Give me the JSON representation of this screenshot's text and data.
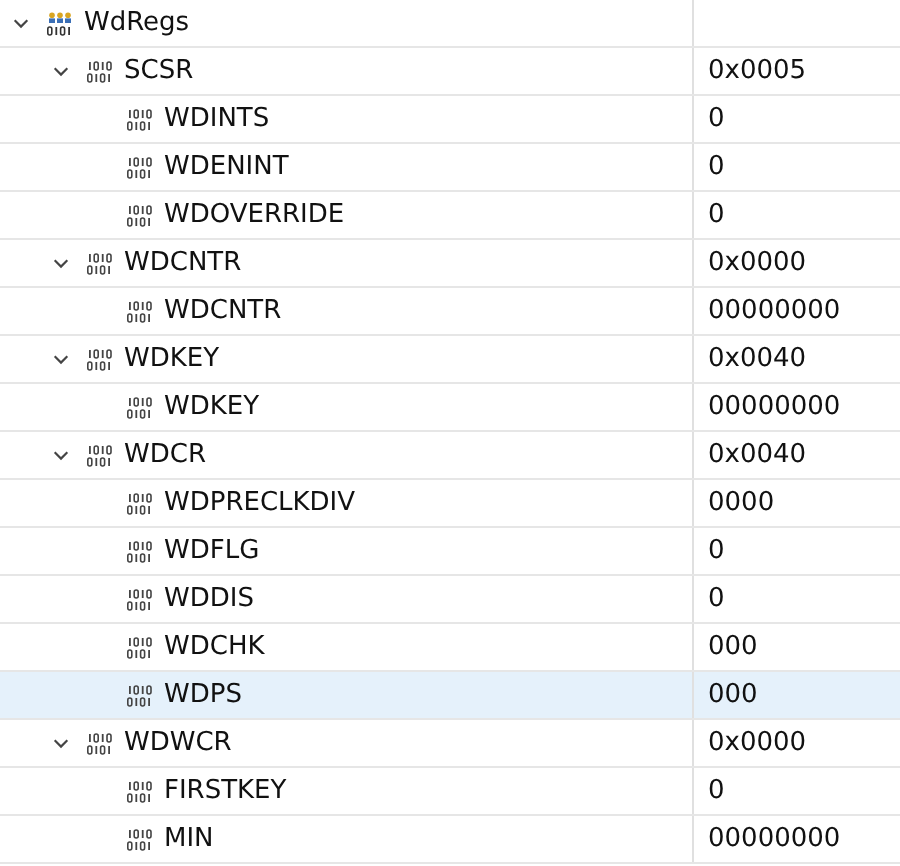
{
  "tree": [
    {
      "kind": "group",
      "name": "WdRegs",
      "expanded": true,
      "selected": false,
      "children": [
        {
          "kind": "register",
          "name": "SCSR",
          "value": "0x0005",
          "expanded": true,
          "selected": false,
          "children": [
            {
              "kind": "field",
              "name": "WDINTS",
              "value": "0",
              "selected": false
            },
            {
              "kind": "field",
              "name": "WDENINT",
              "value": "0",
              "selected": false
            },
            {
              "kind": "field",
              "name": "WDOVERRIDE",
              "value": "0",
              "selected": false
            }
          ]
        },
        {
          "kind": "register",
          "name": "WDCNTR",
          "value": "0x0000",
          "expanded": true,
          "selected": false,
          "children": [
            {
              "kind": "field",
              "name": "WDCNTR",
              "value": "00000000",
              "selected": false
            }
          ]
        },
        {
          "kind": "register",
          "name": "WDKEY",
          "value": "0x0040",
          "expanded": true,
          "selected": false,
          "children": [
            {
              "kind": "field",
              "name": "WDKEY",
              "value": "00000000",
              "selected": false
            }
          ]
        },
        {
          "kind": "register",
          "name": "WDCR",
          "value": "0x0040",
          "expanded": true,
          "selected": false,
          "children": [
            {
              "kind": "field",
              "name": "WDPRECLKDIV",
              "value": "0000",
              "selected": false
            },
            {
              "kind": "field",
              "name": "WDFLG",
              "value": "0",
              "selected": false
            },
            {
              "kind": "field",
              "name": "WDDIS",
              "value": "0",
              "selected": false
            },
            {
              "kind": "field",
              "name": "WDCHK",
              "value": "000",
              "selected": false
            },
            {
              "kind": "field",
              "name": "WDPS",
              "value": "000",
              "selected": true
            }
          ]
        },
        {
          "kind": "register",
          "name": "WDWCR",
          "value": "0x0000",
          "expanded": true,
          "selected": false,
          "children": [
            {
              "kind": "field",
              "name": "FIRSTKEY",
              "value": "0",
              "selected": false
            },
            {
              "kind": "field",
              "name": "MIN",
              "value": "00000000",
              "selected": false
            }
          ]
        }
      ]
    }
  ]
}
